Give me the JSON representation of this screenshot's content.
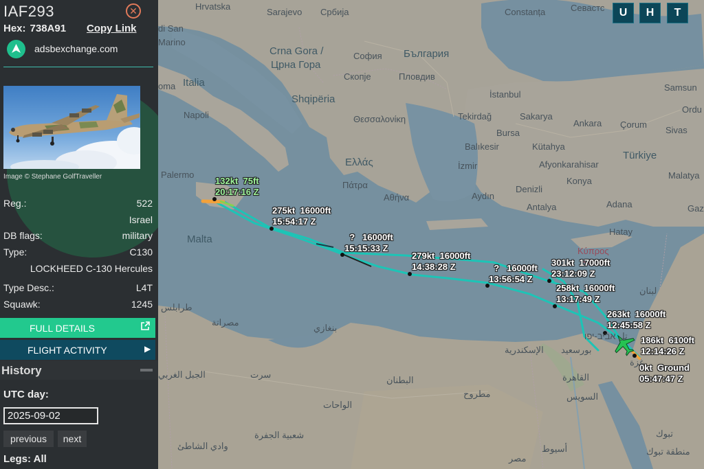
{
  "sidebar": {
    "callsign": "IAF293",
    "hex_label": "Hex:",
    "hex_value": "738A91",
    "copy_link": "Copy Link",
    "site": "adsbexchange.com",
    "image_credit": "Image © Stephane GolfTraveller",
    "reg_label": "Reg.:",
    "reg_value": "522",
    "country": "Israel",
    "dbflags_label": "DB flags:",
    "dbflags_value": "military",
    "type_label": "Type:",
    "type_value": "C130",
    "type_full": "LOCKHEED C-130 Hercules",
    "typedesc_label": "Type Desc.:",
    "typedesc_value": "L4T",
    "squawk_label": "Squawk:",
    "squawk_value": "1245",
    "full_details": "FULL DETAILS",
    "flight_activity": "FLIGHT ACTIVITY",
    "history": "History",
    "utc_day_label": "UTC day:",
    "utc_day_value": "2025-09-02",
    "previous": "previous",
    "next": "next",
    "legs": "Legs: All"
  },
  "map": {
    "buttons": [
      "U",
      "H",
      "T"
    ],
    "places": [
      {
        "t": "Hrvatska"
      },
      {
        "t": "Sarajevo"
      },
      {
        "t": "Србија"
      },
      {
        "t": "Constanța"
      },
      {
        "t": "Севастс"
      },
      {
        "t": "di San"
      },
      {
        "t": "Marino"
      },
      {
        "t": "oma"
      },
      {
        "t": "Italia"
      },
      {
        "t": "Crna Gora /"
      },
      {
        "t": "Црна Гора"
      },
      {
        "t": "София"
      },
      {
        "t": "България"
      },
      {
        "t": "Скопје"
      },
      {
        "t": "Пловдив"
      },
      {
        "t": "Shqipëria"
      },
      {
        "t": "Samsun"
      },
      {
        "t": "İstanbul"
      },
      {
        "t": "Napoli"
      },
      {
        "t": "Θεσσαλονίκη"
      },
      {
        "t": "Tekirdağ"
      },
      {
        "t": "Sakarya"
      },
      {
        "t": "Ordu"
      },
      {
        "t": "Ankara"
      },
      {
        "t": "Çorum"
      },
      {
        "t": "Sivas"
      },
      {
        "t": "Bursa"
      },
      {
        "t": "Balıkesir"
      },
      {
        "t": "Kütahya"
      },
      {
        "t": "Türkiye"
      },
      {
        "t": "Ελλάς"
      },
      {
        "t": "İzmir"
      },
      {
        "t": "Afyonkarahisar"
      },
      {
        "t": "Palermo"
      },
      {
        "t": "Πάτρα"
      },
      {
        "t": "Konya"
      },
      {
        "t": "Malatya"
      },
      {
        "t": "Αθήνα"
      },
      {
        "t": "Denizli"
      },
      {
        "t": "Aydın"
      },
      {
        "t": "Antalya"
      },
      {
        "t": "Adana"
      },
      {
        "t": "Gaz"
      },
      {
        "t": "Malta"
      },
      {
        "t": "Hatay"
      },
      {
        "t": "Κύπρος"
      },
      {
        "t": "Kıbrıs"
      },
      {
        "t": "طرابلس"
      },
      {
        "t": "مصراتة"
      },
      {
        "t": "بنغازي"
      },
      {
        "t": "لبنان"
      },
      {
        "t": "الإسكندرية"
      },
      {
        "t": "بورسعيد"
      },
      {
        "t": "تل אביב-יפו"
      },
      {
        "t": "غزة"
      },
      {
        "t": "الجبل الغربي"
      },
      {
        "t": "سرت"
      },
      {
        "t": "البطنان"
      },
      {
        "t": "القاهرة"
      },
      {
        "t": "مطروح"
      },
      {
        "t": "الواحات"
      },
      {
        "t": "السويس"
      },
      {
        "t": "شعبية الجفرة"
      },
      {
        "t": "تبوك"
      },
      {
        "t": "وادي الشاطئ"
      },
      {
        "t": "منطقة تبوك"
      },
      {
        "t": "أسيوط"
      },
      {
        "t": "مصر"
      }
    ],
    "labels": [
      {
        "speed": "132kt",
        "alt": "75ft",
        "time": "20:17:16 Z",
        "green": true
      },
      {
        "speed": "275kt",
        "alt": "16000ft",
        "time": "15:54:17 Z"
      },
      {
        "speed": "?",
        "alt": "16000ft",
        "time": "15:15:33 Z"
      },
      {
        "speed": "279kt",
        "alt": "16000ft",
        "time": "14:38:28 Z"
      },
      {
        "speed": "?",
        "alt": "16000ft",
        "time": "13:56:54 Z"
      },
      {
        "speed": "301kt",
        "alt": "17000ft",
        "time": "23:12:09 Z"
      },
      {
        "speed": "258kt",
        "alt": "16000ft",
        "time": "13:17:49 Z"
      },
      {
        "speed": "263kt",
        "alt": "16000ft",
        "time": "12:45:58 Z"
      },
      {
        "speed": "186kt",
        "alt": "6100ft",
        "time": "12:14:26 Z"
      },
      {
        "speed": "0kt",
        "alt": "Ground",
        "time": "05:47:47 Z"
      }
    ]
  },
  "colors": {
    "track": "#1dc4b6",
    "sea": "#7a95a6",
    "land": "#a8a39a",
    "accent": "#22c98e",
    "dark_btn": "#0f4a5f"
  }
}
